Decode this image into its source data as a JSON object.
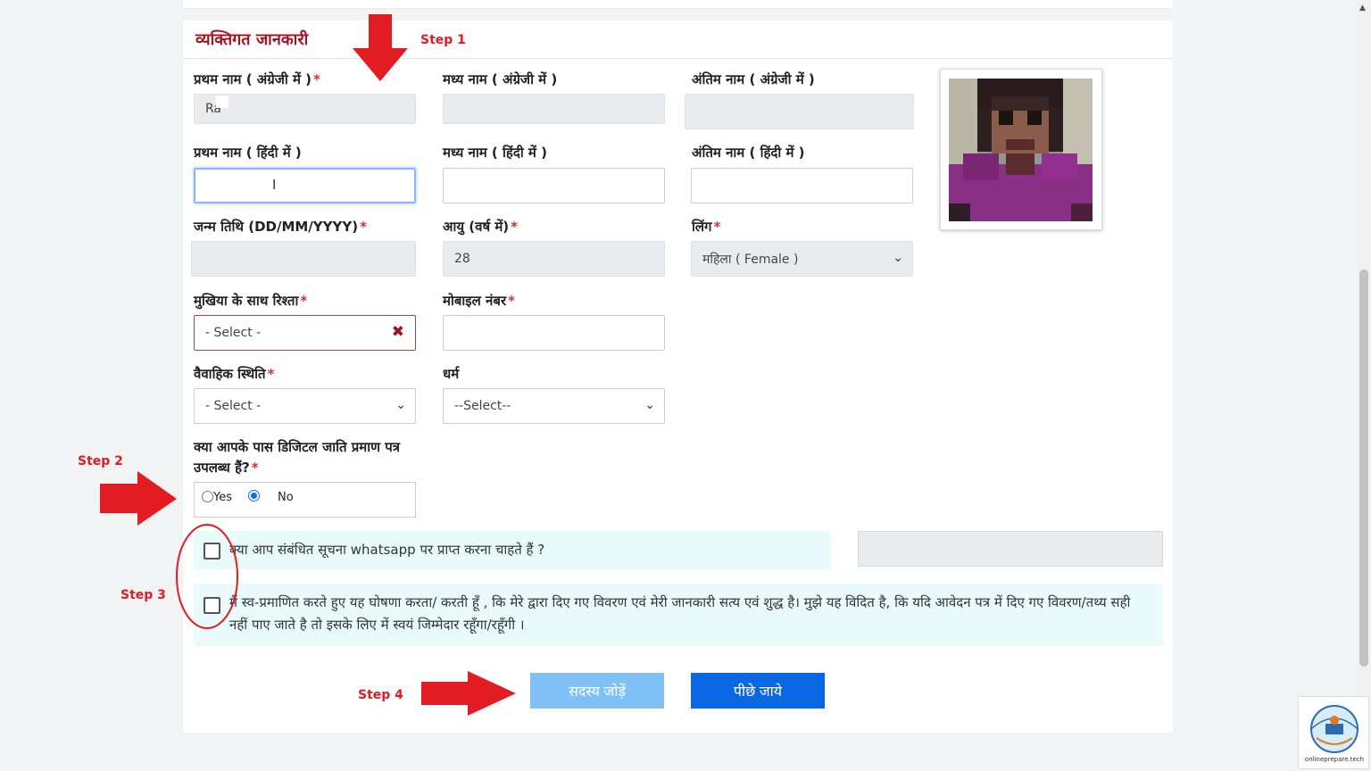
{
  "section": {
    "title": "व्यक्तिगत जानकारी"
  },
  "fields": {
    "first_name_en": {
      "label": "प्रथम नाम ( अंग्रेजी में )",
      "value": "Ra"
    },
    "middle_name_en": {
      "label": "मध्य नाम ( अंग्रेजी में )",
      "value": ""
    },
    "last_name_en": {
      "label": "अंतिम नाम ( अंग्रेजी में )",
      "value": ""
    },
    "first_name_hi": {
      "label": "प्रथम नाम ( हिंदी में )",
      "value": ""
    },
    "middle_name_hi": {
      "label": "मध्य नाम ( हिंदी में )",
      "value": ""
    },
    "last_name_hi": {
      "label": "अंतिम नाम ( हिंदी में )",
      "value": ""
    },
    "dob": {
      "label": "जन्म तिथि (DD/MM/YYYY)",
      "value": ""
    },
    "age": {
      "label": "आयु (वर्ष में)",
      "value": "28"
    },
    "gender": {
      "label": "लिंग",
      "value": "महिला ( Female )"
    },
    "relation": {
      "label": "मुखिया के साथ रिश्ता",
      "value": "- Select -"
    },
    "mobile": {
      "label": "मोबाइल नंबर",
      "value": ""
    },
    "marital": {
      "label": "वैवाहिक स्थिति",
      "value": "- Select -"
    },
    "religion": {
      "label": "धर्म",
      "value": "--Select--"
    },
    "caste_cert": {
      "label": "क्या आपके पास डिजिटल जाति प्रमाण पत्र उपलब्ध हैं?",
      "yes": "Yes",
      "no": "No",
      "selected": "No"
    }
  },
  "required_mark": "*",
  "consent": {
    "whatsapp": "क्या आप संबंधित सूचना whatsapp पर प्राप्त करना चाहते हैं ?",
    "declaration": "मैं स्व-प्रमाणित करते हुए यह घोषणा करता/ करती हूँ , कि मेरे द्वारा दिए गए विवरण एवं मेरी जानकारी सत्य एवं शुद्ध है। मुझे यह विदित है, कि यदि आवेदन पत्र में दिए गए विवरण/तथ्य सही नहीं पाए जाते है तो इसके लिए में स्वयं जिम्मेदार रहूँगा/रहूँगी ।"
  },
  "buttons": {
    "add_member": "सदस्य जोड़ें",
    "go_back": "पीछे जाये"
  },
  "steps": {
    "s1": "Step 1",
    "s2": "Step 2",
    "s3": "Step 3",
    "s4": "Step 4"
  },
  "watermark": {
    "text": "onlineprepare.tech"
  },
  "colors": {
    "title": "#a3141f",
    "step": "#e31b23",
    "primary": "#0a67e3",
    "primary_light": "#7fc0f7",
    "consent_bg": "#e8fbfa"
  }
}
